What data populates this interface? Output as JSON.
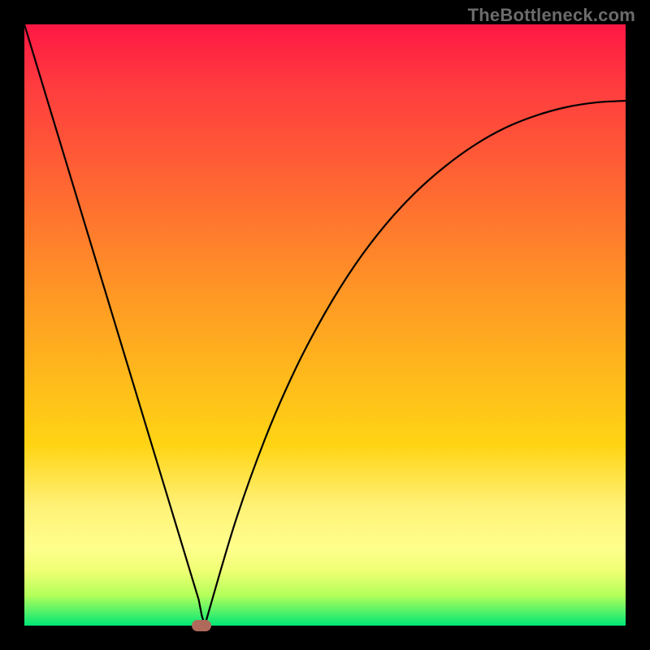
{
  "watermark": "TheBottleneck.com",
  "chart_data": {
    "type": "line",
    "title": "",
    "xlabel": "",
    "ylabel": "",
    "xlim": [
      0,
      100
    ],
    "ylim": [
      0,
      100
    ],
    "grid": false,
    "legend": false,
    "series": [
      {
        "name": "curve",
        "x": [
          0,
          5,
          10,
          15,
          20,
          25,
          28,
          29,
          29.5,
          30,
          35,
          40,
          45,
          50,
          55,
          60,
          65,
          70,
          75,
          80,
          85,
          90,
          95,
          100
        ],
        "y": [
          100,
          83.5,
          67,
          50.5,
          34,
          17.5,
          7.6,
          4.3,
          1.7,
          0,
          17,
          31,
          42.5,
          52,
          60,
          66.6,
          72,
          76.4,
          80,
          82.8,
          84.8,
          86.2,
          87,
          87.3
        ]
      }
    ],
    "annotations": [
      {
        "type": "marker",
        "shape": "pill",
        "x": 29.5,
        "y": 0,
        "color": "#b06a5c"
      }
    ],
    "background_gradient": {
      "direction": "vertical",
      "stops": [
        {
          "pos": 0.0,
          "color": "#ff1744"
        },
        {
          "pos": 0.5,
          "color": "#ffb81c"
        },
        {
          "pos": 0.85,
          "color": "#ffff8d"
        },
        {
          "pos": 1.0,
          "color": "#00e676"
        }
      ]
    }
  }
}
